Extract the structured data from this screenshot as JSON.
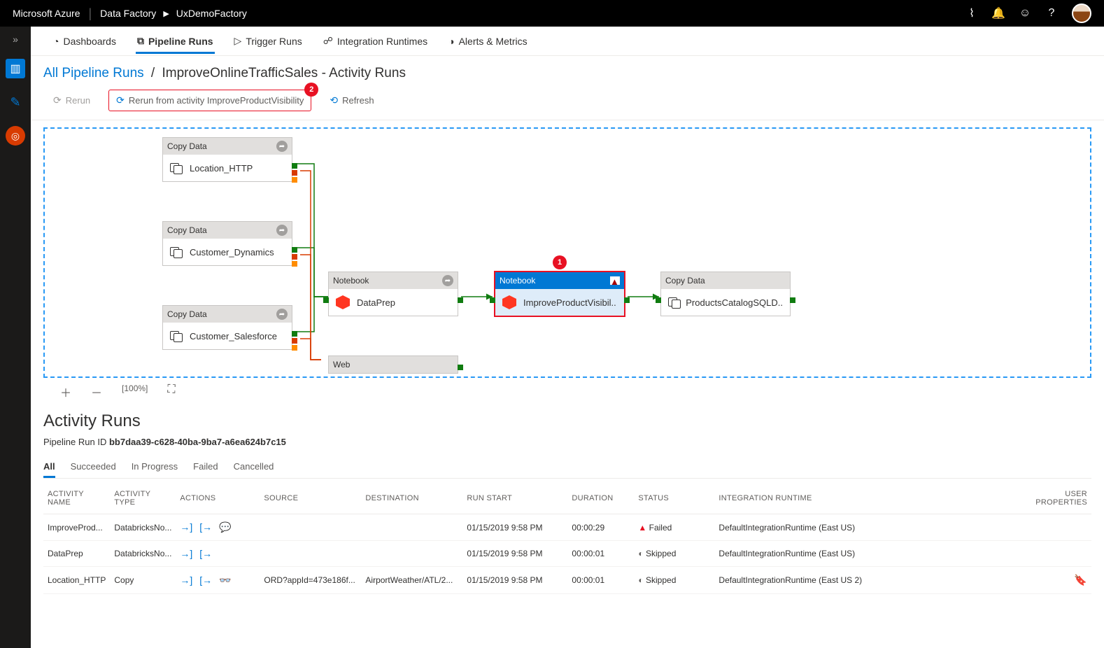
{
  "topbar": {
    "brand": "Microsoft Azure",
    "service": "Data Factory",
    "factory": "UxDemoFactory"
  },
  "nav": {
    "dashboards": "Dashboards",
    "pipelineRuns": "Pipeline Runs",
    "triggerRuns": "Trigger Runs",
    "integrationRuntimes": "Integration Runtimes",
    "alerts": "Alerts & Metrics"
  },
  "breadcrumb": {
    "root": "All Pipeline Runs",
    "current": "ImproveOnlineTrafficSales - Activity Runs"
  },
  "actions": {
    "rerun": "Rerun",
    "rerunFrom": "Rerun from activity ImproveProductVisibility",
    "refresh": "Refresh",
    "badge2": "2",
    "badge1": "1"
  },
  "nodes": {
    "copyData": "Copy Data",
    "notebook": "Notebook",
    "web": "Web",
    "loc": "Location_HTTP",
    "custDyn": "Customer_Dynamics",
    "custSf": "Customer_Salesforce",
    "dataPrep": "DataPrep",
    "improve": "ImproveProductVisibil..",
    "products": "ProductsCatalogSQLD.."
  },
  "activitySection": {
    "title": "Activity Runs",
    "runIdLabel": "Pipeline Run ID ",
    "runId": "bb7daa39-c628-40ba-9ba7-a6ea624b7c15"
  },
  "filters": {
    "all": "All",
    "succeeded": "Succeeded",
    "inprog": "In Progress",
    "failed": "Failed",
    "cancelled": "Cancelled"
  },
  "cols": {
    "name": "Activity Name",
    "type": "Activity Type",
    "actions": "Actions",
    "source": "Source",
    "dest": "Destination",
    "start": "Run Start",
    "dur": "Duration",
    "status": "Status",
    "ir": "Integration Runtime",
    "up": "User Properties"
  },
  "rows": [
    {
      "name": "ImproveProd...",
      "type": "DatabricksNo...",
      "source": "",
      "dest": "",
      "start": "01/15/2019 9:58 PM",
      "dur": "00:00:29",
      "status": "Failed",
      "ir": "DefaultIntegrationRuntime (East US)",
      "hasChat": true,
      "hasGlasses": false
    },
    {
      "name": "DataPrep",
      "type": "DatabricksNo...",
      "source": "",
      "dest": "",
      "start": "01/15/2019 9:58 PM",
      "dur": "00:00:01",
      "status": "Skipped",
      "ir": "DefaultIntegrationRuntime (East US)",
      "hasChat": false,
      "hasGlasses": false
    },
    {
      "name": "Location_HTTP",
      "type": "Copy",
      "source": "ORD?appId=473e186f...",
      "dest": "AirportWeather/ATL/2...",
      "start": "01/15/2019 9:58 PM",
      "dur": "00:00:01",
      "status": "Skipped",
      "ir": "DefaultIntegrationRuntime (East US 2)",
      "hasChat": false,
      "hasGlasses": true
    }
  ]
}
